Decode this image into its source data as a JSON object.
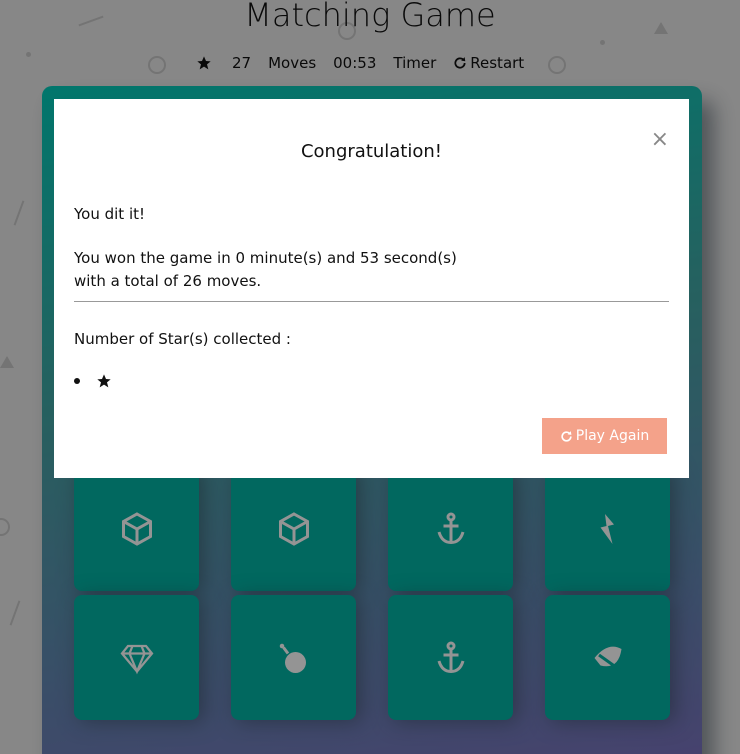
{
  "header": {
    "title": "Matching Game"
  },
  "score_panel": {
    "star_icon": "star-icon",
    "moves_count": "27",
    "moves_label": "Moves",
    "timer_value": "00:53",
    "timer_label": "Timer",
    "restart_label": "Restart"
  },
  "deck": {
    "card_color": "#02b3a4",
    "cards": [
      {
        "icon": "cube-icon"
      },
      {
        "icon": "cube-icon"
      },
      {
        "icon": "anchor-icon"
      },
      {
        "icon": "bolt-icon"
      },
      {
        "icon": "diamond-icon"
      },
      {
        "icon": "bomb-icon"
      },
      {
        "icon": "anchor-icon"
      },
      {
        "icon": "leaf-icon"
      }
    ]
  },
  "modal": {
    "title": "Congratulation!",
    "close_label": "×",
    "line1": "You dit it!",
    "line2": "You won the game in 0 minute(s) and 53 second(s)",
    "line3": "with a total of 26 moves.",
    "stars_label": "Number of Star(s) collected :",
    "stars_collected": 1,
    "play_again_label": "Play Again",
    "accent_color": "#f4a28a"
  }
}
